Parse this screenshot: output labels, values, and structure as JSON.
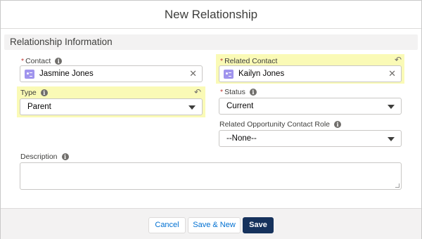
{
  "modal": {
    "title": "New Relationship"
  },
  "section": {
    "title": "Relationship Information"
  },
  "fields": {
    "contact": {
      "required": "*",
      "label": "Contact",
      "value": "Jasmine Jones",
      "clear": "✕"
    },
    "related_contact": {
      "required": "*",
      "label": "Related Contact",
      "value": "Kailyn Jones",
      "clear": "✕"
    },
    "type": {
      "label": "Type",
      "value": "Parent"
    },
    "status": {
      "required": "*",
      "label": "Status",
      "value": "Current"
    },
    "role": {
      "label": "Related Opportunity Contact Role",
      "value": "--None--"
    },
    "description": {
      "label": "Description",
      "value": ""
    }
  },
  "icons": {
    "info": "i",
    "undo": "↶"
  },
  "footer": {
    "cancel": "Cancel",
    "save_new": "Save & New",
    "save": "Save"
  },
  "colors": {
    "highlight": "#fafab6",
    "brand": "#16325c",
    "link": "#0070d2",
    "contact_icon": "#a094ed",
    "required": "#c23934"
  }
}
